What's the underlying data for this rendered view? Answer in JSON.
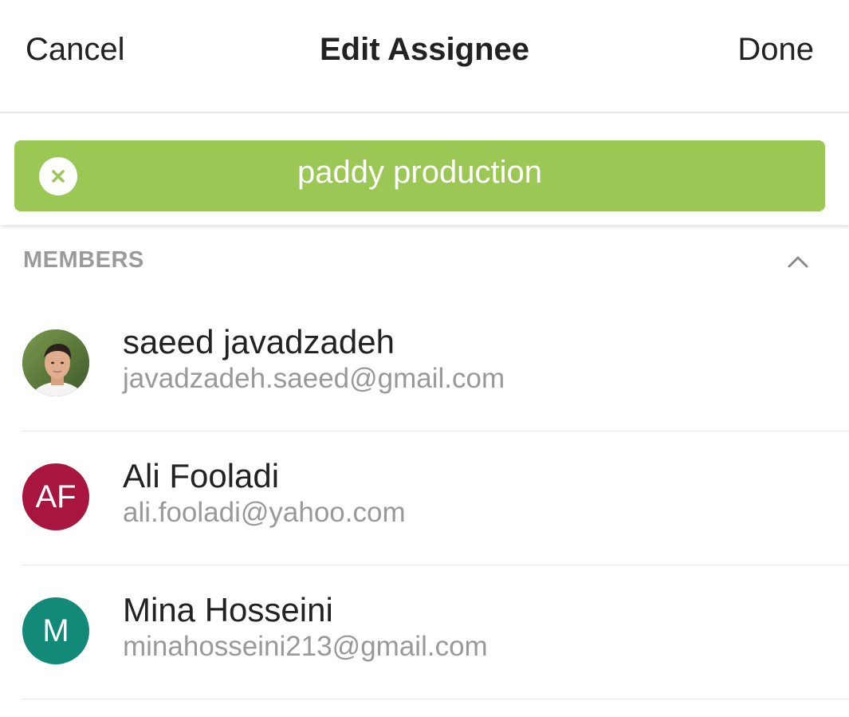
{
  "header": {
    "cancel_label": "Cancel",
    "title": "Edit Assignee",
    "done_label": "Done"
  },
  "selected_chip": {
    "label": "paddy production",
    "icon": "close-icon",
    "color": "#9bc755"
  },
  "members_section": {
    "title": "MEMBERS",
    "toggle_icon": "chevron-up-icon",
    "items": [
      {
        "name": "saeed javadzadeh",
        "email": "javadzadeh.saeed@gmail.com",
        "avatar_initials": "",
        "avatar_type": "photo"
      },
      {
        "name": "Ali Fooladi",
        "email": "ali.fooladi@yahoo.com",
        "avatar_initials": "AF",
        "avatar_color": "#a8153f"
      },
      {
        "name": "Mina Hosseini",
        "email": "minahosseini213@gmail.com",
        "avatar_initials": "M",
        "avatar_color": "#13897a"
      }
    ]
  }
}
